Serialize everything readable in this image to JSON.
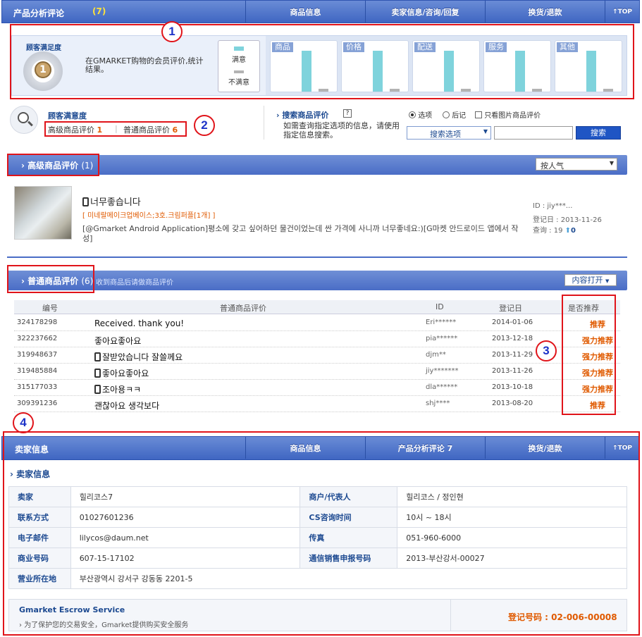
{
  "top_bar": {
    "title": "产品分析评论",
    "count": "(7)",
    "tabs": [
      "商品信息",
      "卖家信息/咨询/回复",
      "换货/退款",
      "↑TOP"
    ]
  },
  "satisfaction": {
    "title": "顾客满足度",
    "desc": "在GMARKET购物的会员评价,统计结果。",
    "legend_good": "满意",
    "legend_bad": "不满意",
    "categories": [
      "商品",
      "价格",
      "配送",
      "服务",
      "其他"
    ],
    "good_values": [
      100,
      100,
      100,
      100,
      100
    ],
    "bad_values": [
      5,
      5,
      5,
      5,
      5
    ]
  },
  "summary": {
    "title": "顾客满意度",
    "premium_label": "高级商品评价",
    "premium_count": "1",
    "normal_label": "普通商品评价",
    "normal_count": "6"
  },
  "search": {
    "title": "搜索商品评价",
    "help": "?",
    "desc": "如需查询指定选项的信息，请使用指定信息搜索。",
    "radio_option": "选项",
    "radio_postscript": "后记",
    "checkbox_label": "只看图片商品评价",
    "select_label": "搜索选项",
    "button": "搜索"
  },
  "premium": {
    "title": "高级商品评价",
    "count": "(1)",
    "sort": "按人气",
    "review": {
      "title": "너무좋습니다",
      "option": "[ 미네랄메이크업베이스;3호.크림퍼플[1개] ]",
      "body": "[@Gmarket Android Application]평소에 갖고 싶어하던 물건이었는데 싼 가격에 사니까 너무좋네요:)[G마켓 안드로이드 앱에서 작성]",
      "id": "ID : jiy***...",
      "date_label": "登记日 : 2013-11-26",
      "views_label": "查询 : 19",
      "votes": "0"
    }
  },
  "normal": {
    "title": "普通商品评价",
    "count": "(6)",
    "subtitle": "收到商品后请做商品评价",
    "open_button": "内容打开",
    "headers": [
      "编号",
      "普通商品评价",
      "ID",
      "登记日",
      "是否推荐"
    ],
    "rows": [
      {
        "no": "324178298",
        "text": "Received. thank you!",
        "mobile": false,
        "id": "Eri******",
        "date": "2014-01-06",
        "rec": "推荐"
      },
      {
        "no": "322237662",
        "text": "좋아요좋아요",
        "mobile": false,
        "id": "pia******",
        "date": "2013-12-18",
        "rec": "强力推荐"
      },
      {
        "no": "319948637",
        "text": "잘받았습니다 잘쓸께요",
        "mobile": true,
        "id": "djm**",
        "date": "2013-11-29",
        "rec": "强力推荐"
      },
      {
        "no": "319485884",
        "text": "좋아요좋아요",
        "mobile": true,
        "id": "jiy*******",
        "date": "2013-11-26",
        "rec": "强力推荐"
      },
      {
        "no": "315177033",
        "text": "조아용ㅋㅋ",
        "mobile": true,
        "id": "dla******",
        "date": "2013-10-18",
        "rec": "强力推荐"
      },
      {
        "no": "309391236",
        "text": "괜찮아요 생각보다",
        "mobile": false,
        "id": "shj****",
        "date": "2013-08-20",
        "rec": "推荐"
      }
    ]
  },
  "seller_bar": {
    "title": "卖家信息",
    "tabs": [
      "商品信息",
      "产品分析评论 7",
      "换货/退款",
      "↑TOP"
    ]
  },
  "seller": {
    "subtitle": "卖家信息",
    "rows": [
      [
        "卖家",
        "힐리코스7",
        "商户/代表人",
        "힐리코스 / 정인현"
      ],
      [
        "联系方式",
        "01027601236",
        "CS咨询时间",
        "10시 ~ 18시"
      ],
      [
        "电子邮件",
        "lilycos@daum.net",
        "传真",
        "051-960-6000"
      ],
      [
        "商业号码",
        "607-15-17102",
        "通信销售申报号码",
        "2013-부산강서-00027"
      ]
    ],
    "address_label": "营业所在地",
    "address": "부산광역시 강서구 강동동 2201-5"
  },
  "escrow": {
    "title": "Gmarket Escrow Service",
    "desc": "为了保护您的交易安全，Gmarket提供购买安全服务",
    "reg": "登记号码 : 02-006-00008"
  },
  "annotations": [
    "1",
    "2",
    "3",
    "4"
  ],
  "colors": {
    "accent": "#4a6dc6",
    "highlight": "#e0141a",
    "recommend": "#e05a00",
    "bar_good": "#7fd3dc"
  }
}
